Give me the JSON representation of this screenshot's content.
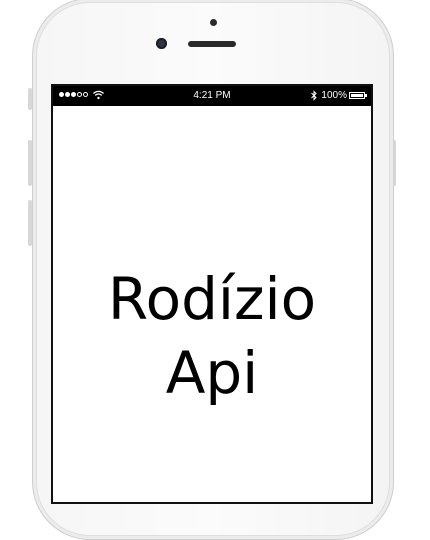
{
  "status_bar": {
    "signal_dots": 5,
    "signal_filled": 3,
    "time": "4:21 PM",
    "battery_label": "100%",
    "battery_level": 1.0,
    "icons": [
      "signal-dots-icon",
      "wifi-icon",
      "bluetooth-icon",
      "battery-icon"
    ]
  },
  "app": {
    "title_line1": "Rodízio",
    "title_line2": "Api"
  },
  "colors": {
    "status_bar_bg": "#000000",
    "screen_bg": "#ffffff",
    "text": "#000000"
  }
}
